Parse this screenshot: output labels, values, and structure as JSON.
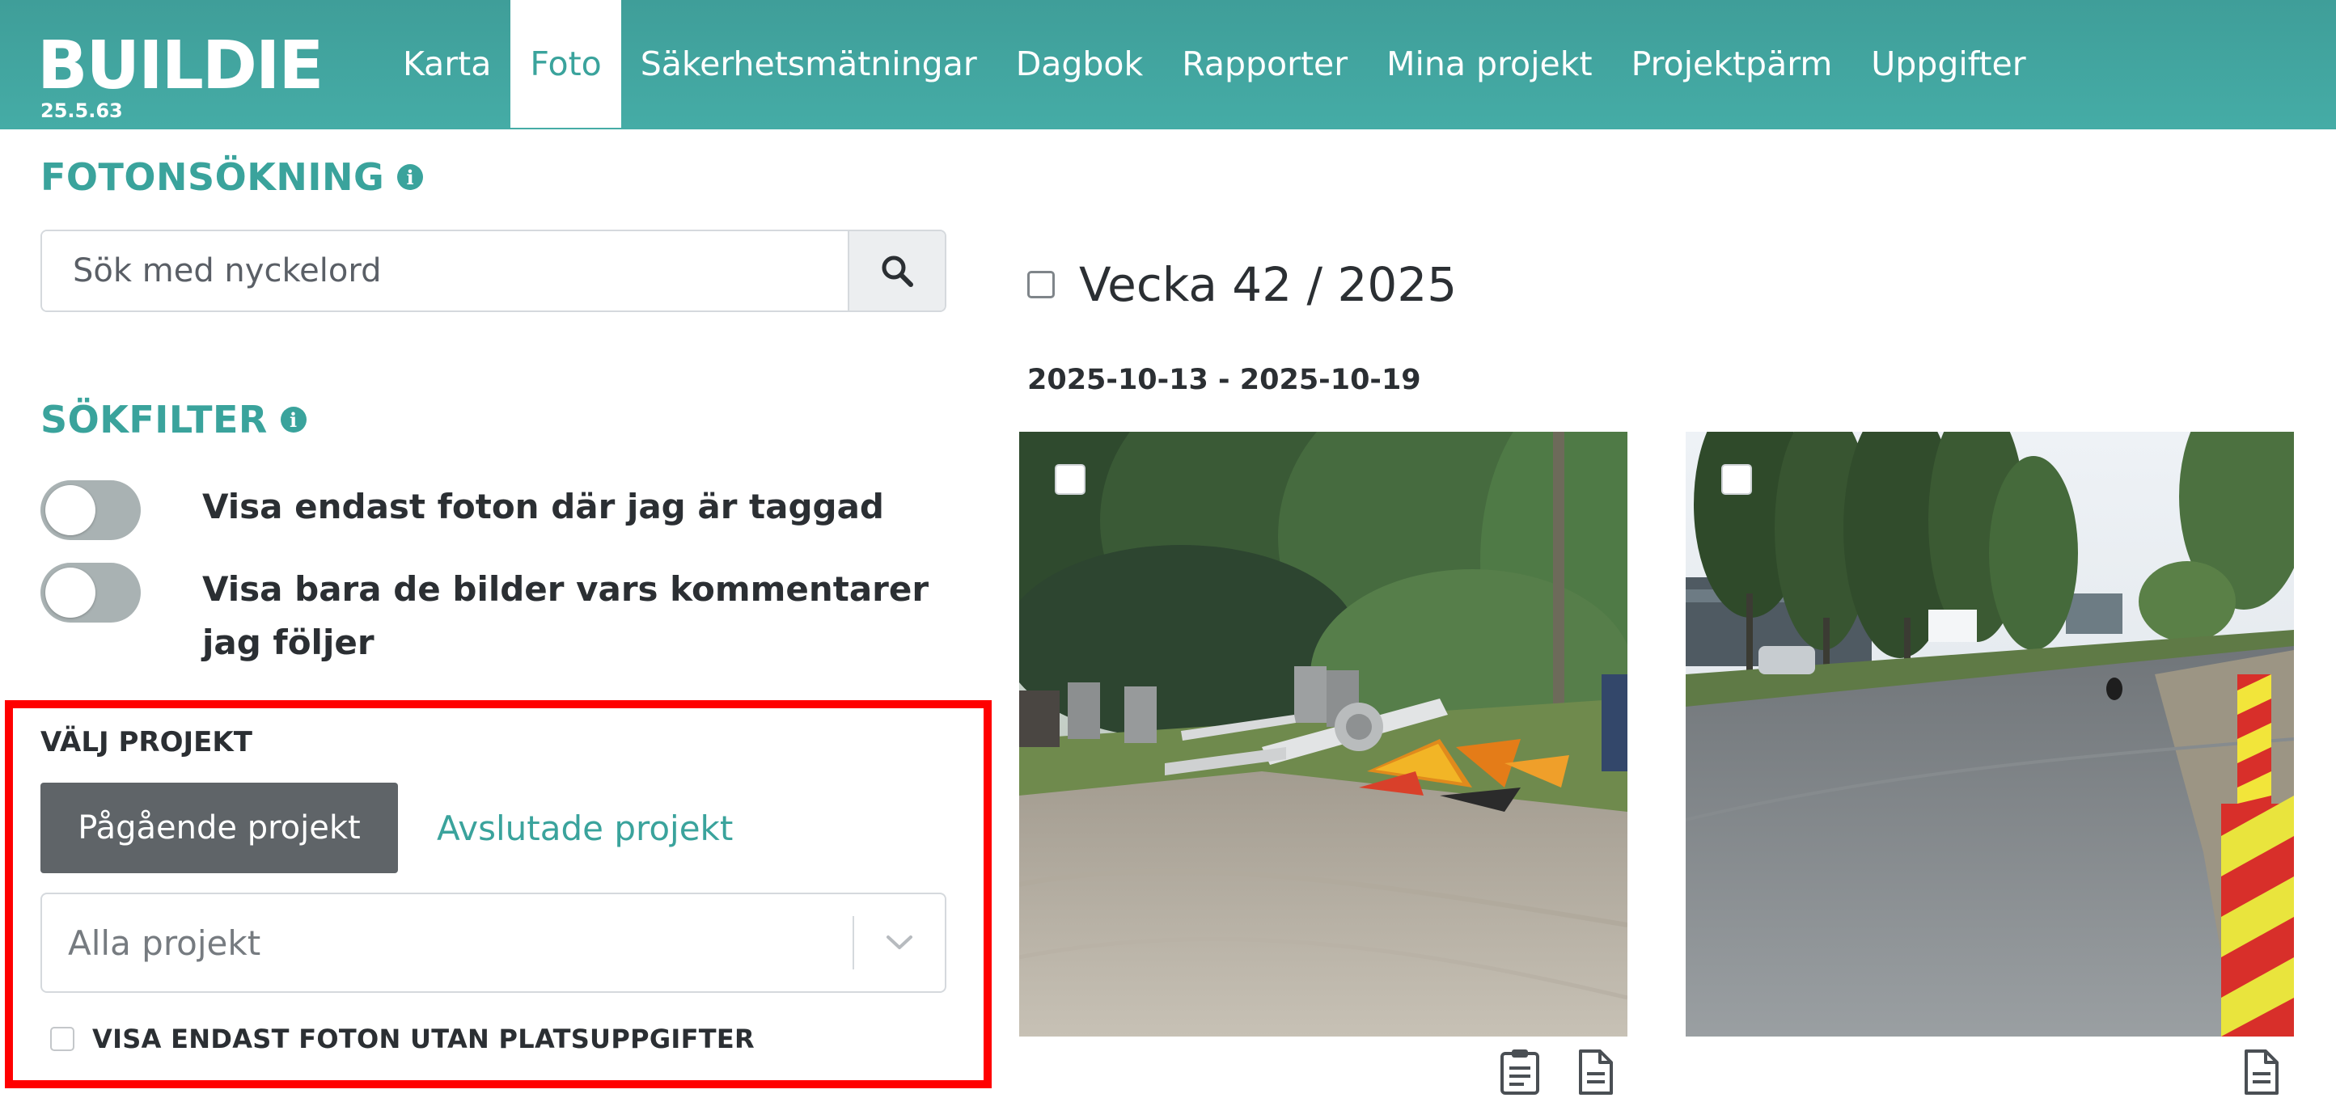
{
  "app": {
    "brand": "BUILDIE",
    "version": "25.5.63",
    "accent_color": "#3aa39c"
  },
  "nav": {
    "items": [
      {
        "label": "Karta",
        "active": false
      },
      {
        "label": "Foto",
        "active": true
      },
      {
        "label": "Säkerhetsmätningar",
        "active": false
      },
      {
        "label": "Dagbok",
        "active": false
      },
      {
        "label": "Rapporter",
        "active": false
      },
      {
        "label": "Mina projekt",
        "active": false
      },
      {
        "label": "Projektpärm",
        "active": false
      },
      {
        "label": "Uppgifter",
        "active": false
      }
    ]
  },
  "search": {
    "title": "FOTONSÖKNING",
    "placeholder": "Sök med nyckelord",
    "value": "",
    "button_icon": "search-icon"
  },
  "filters": {
    "title": "SÖKFILTER",
    "toggles": [
      {
        "label": "Visa endast foton där jag är taggad",
        "on": false
      },
      {
        "label": "Visa bara de bilder vars kommentarer jag följer",
        "on": false
      }
    ]
  },
  "project": {
    "label": "VÄLJ PROJEKT",
    "ongoing_button": "Pågående projekt",
    "finished_link": "Avslutade projekt",
    "select_value": "Alla projekt",
    "no_location_checkbox": "VISA ENDAST FOTON UTAN PLATSUPPGIFTER"
  },
  "gallery": {
    "week_title": "Vecka 42 / 2025",
    "date_range": "2025-10-13 - 2025-10-19",
    "photos": [
      {
        "scene": "construction-site-with-road-signs",
        "icons": [
          "clipboard-icon",
          "document-icon"
        ]
      },
      {
        "scene": "asphalt-road-with-trees",
        "icons": [
          "document-icon"
        ]
      }
    ]
  }
}
